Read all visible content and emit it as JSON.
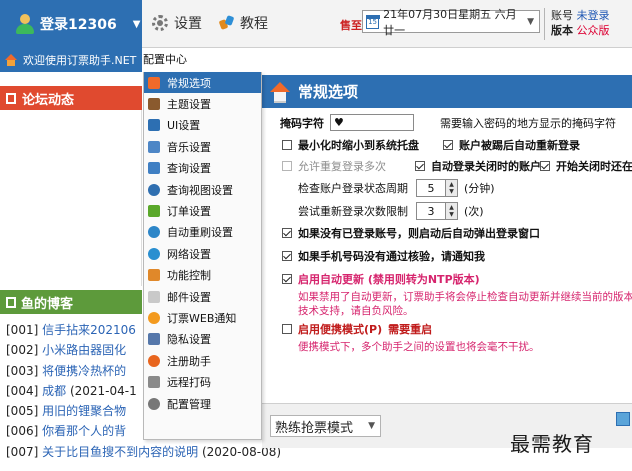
{
  "toolbar": {
    "login_label": "登录12306",
    "settings_label": "设置",
    "tutorial_label": "教程",
    "sale_label": "售至",
    "date_value": "21年07月30日星期五 六月廿一",
    "account": {
      "account_label": "账号",
      "account_value": "未登录",
      "version_label": "版本",
      "version_value": "公众版"
    }
  },
  "welcome_text": "欢迎使用订票助手.NET",
  "config_center_label": "配置中心",
  "forum_title": "论坛动态",
  "blog_title": "鱼的博客",
  "blog_items": [
    {
      "index": "[001]",
      "title": "信手拈来202106",
      "date": ""
    },
    {
      "index": "[002]",
      "title": "小米路由器固化",
      "date": ""
    },
    {
      "index": "[003]",
      "title": "将便携冷热杯的",
      "date": ""
    },
    {
      "index": "[004]",
      "title": "成都",
      "date": "(2021-04-1"
    },
    {
      "index": "[005]",
      "title": "用旧的锂聚合物",
      "date": ""
    },
    {
      "index": "[006]",
      "title": "你看那个人的背",
      "date": ""
    },
    {
      "index": "[007]",
      "title": "关于比目鱼搜不到内容的说明",
      "date": "(2020-08-08)"
    }
  ],
  "menu_items": [
    {
      "label": "常规选项",
      "icon": "house-icon",
      "color": "#f06a2a",
      "active": true
    },
    {
      "label": "主题设置",
      "icon": "brush-icon",
      "color": "#8a5a2e",
      "active": false
    },
    {
      "label": "UI设置",
      "icon": "monitor-icon",
      "color": "#2d6fb2",
      "active": false
    },
    {
      "label": "音乐设置",
      "icon": "speaker-icon",
      "color": "#4d86c6",
      "active": false
    },
    {
      "label": "查询设置",
      "icon": "list-icon",
      "color": "#3f7fc3",
      "active": false
    },
    {
      "label": "查询视图设置",
      "icon": "magnifier-icon",
      "color": "#2f6fb0",
      "active": false
    },
    {
      "label": "订单设置",
      "icon": "cart-icon",
      "color": "#5aa82a",
      "active": false
    },
    {
      "label": "自动重刷设置",
      "icon": "refresh-icon",
      "color": "#2d86c8",
      "active": false
    },
    {
      "label": "网络设置",
      "icon": "globe-icon",
      "color": "#2a8fd0",
      "active": false
    },
    {
      "label": "功能控制",
      "icon": "controls-icon",
      "color": "#e0882a",
      "active": false
    },
    {
      "label": "邮件设置",
      "icon": "mail-icon",
      "color": "#9a9a9a",
      "active": false
    },
    {
      "label": "订票WEB通知",
      "icon": "web-icon",
      "color": "#f39a1e",
      "active": false
    },
    {
      "label": "隐私设置",
      "icon": "umbrella-icon",
      "color": "#5577aa",
      "active": false
    },
    {
      "label": "注册助手",
      "icon": "heart-icon",
      "color": "#e8651e",
      "active": false
    },
    {
      "label": "远程打码",
      "icon": "key-icon",
      "color": "#8a8a8a",
      "active": false
    },
    {
      "label": "配置管理",
      "icon": "gear-icon",
      "color": "#777777",
      "active": false
    }
  ],
  "pane": {
    "title": "常规选项",
    "mask_label": "掩码字符",
    "mask_value": "♥",
    "mask_hint": "需要输入密码的地方显示的掩码字符",
    "minimize_tray": "最小化时缩小到系统托盘",
    "auto_relogin": "账户被踢后自动重新登录",
    "allow_repeat_login": "允许重复登录多次",
    "auto_login_closed": "自动登录关闭时的账户",
    "auto_start_on_open": "开始关闭时还在运",
    "check_interval_label": "检查账户登录状态周期",
    "check_interval_value": "5",
    "check_interval_unit": "(分钟)",
    "retry_label": "尝试重新登录次数限制",
    "retry_value": "3",
    "retry_unit": "(次)",
    "popup_login_window": "如果没有已登录账号，则启动后自动弹出登录窗口",
    "phone_unverified_reminder": "如果手机号码没有通过核验，请通知我",
    "enable_auto_update": "启用自动更新 (禁用则转为NTP版本)",
    "auto_update_note_1": "如果禁用了自动更新，订票助手将会停止检查自动更新并继续当前的版本日不",
    "auto_update_note_2": "技术支持，请自负风险。",
    "enable_portable": "启用便携模式(P)",
    "portable_restart": "需要重启",
    "portable_note": "便携模式下，多个助手之间的设置也将会毫不干扰。"
  },
  "mode_select_value": "熟练抢票模式",
  "watermark_text": "最需教育",
  "colors": {
    "accent_blue": "#2d6fb2",
    "forum_red": "#e04a2f",
    "blog_green": "#5d9a3b",
    "warning_pink": "#d6246d"
  }
}
